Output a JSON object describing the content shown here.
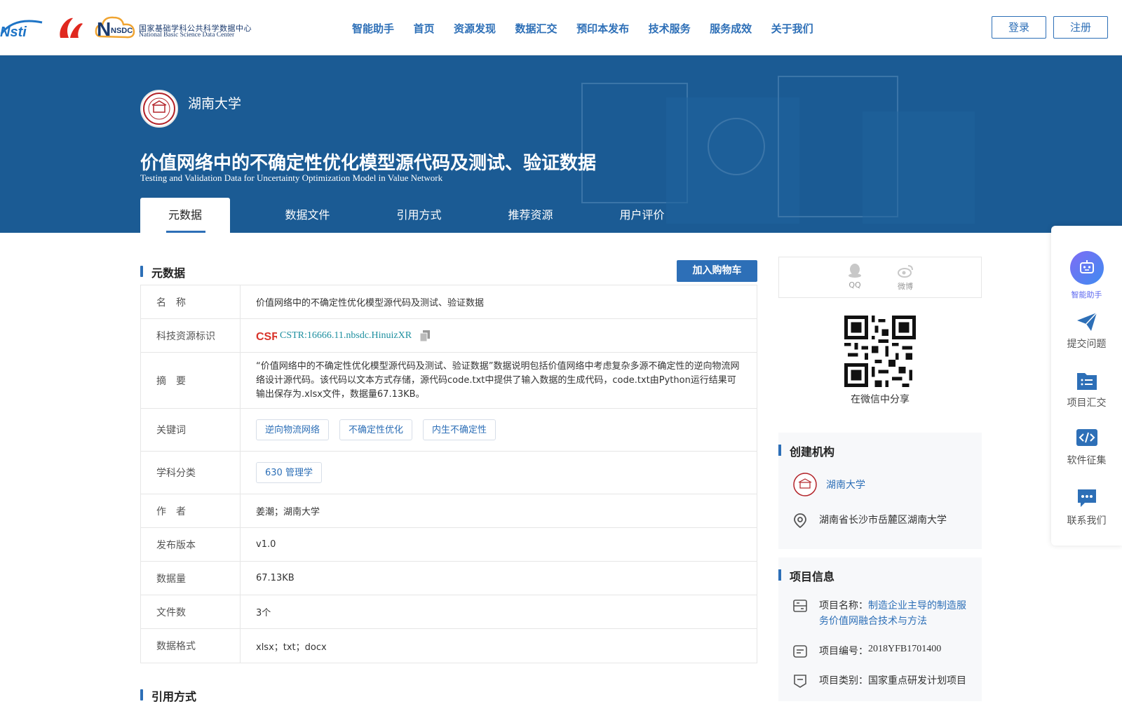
{
  "header": {
    "logo_nsdc_cn": "国家基础学科公共科学数据中心",
    "logo_nsdc_en": "National Basic Science Data Center",
    "logo_nsdc_mark": "NSDC",
    "nav": [
      "智能助手",
      "首页",
      "资源发现",
      "数据汇交",
      "预印本发布",
      "技术服务",
      "服务成效",
      "关于我们"
    ],
    "login": "登录",
    "register": "注册"
  },
  "banner": {
    "org_name": "湖南大学",
    "title_cn": "价值网络中的不确定性优化模型源代码及测试、验证数据",
    "title_en": "Testing and Validation Data for Uncertainty Optimization Model in Value Network",
    "tabs": [
      "元数据",
      "数据文件",
      "引用方式",
      "推荐资源",
      "用户评价"
    ]
  },
  "metadata": {
    "section_title": "元数据",
    "cart_button": "加入购物车",
    "rows": {
      "name_label": "名　称",
      "name_value": "价值网络中的不确定性优化模型源代码及测试、验证数据",
      "cstr_label": "科技资源标识",
      "cstr_value": "CSTR:16666.11.nbsdc.HinuizXR",
      "abstract_label": "摘　要",
      "abstract_value": "“价值网络中的不确定性优化模型源代码及测试、验证数据”数据说明包括价值网络中考虑复杂多源不确定性的逆向物流网络设计源代码。该代码以文本方式存储，源代码code.txt中提供了输入数据的生成代码，code.txt由Python运行结果可输出保存为.xlsx文件，数据量67.13KB。",
      "keywords_label": "关键词",
      "keywords": [
        "逆向物流网络",
        "不确定性优化",
        "内生不确定性"
      ],
      "subject_label": "学科分类",
      "subject": "630 管理学",
      "author_label": "作　者",
      "author_value": "姜潮；湖南大学",
      "version_label": "发布版本",
      "version_value": "v1.0",
      "size_label": "数据量",
      "size_value": "67.13KB",
      "files_label": "文件数",
      "files_value": "3个",
      "format_label": "数据格式",
      "format_value": "xlsx；txt；docx"
    }
  },
  "citation": {
    "section_title": "引用方式"
  },
  "share": {
    "qq": "QQ",
    "weibo": "微博",
    "wechat_caption": "在微信中分享"
  },
  "creator": {
    "title": "创建机构",
    "org": "湖南大学",
    "address": "湖南省长沙市岳麓区湖南大学"
  },
  "project": {
    "title": "项目信息",
    "name_label": "项目名称：",
    "name_value": "制造企业主导的制造服务价值网融合技术与方法",
    "number_label": "项目编号：",
    "number_value": "2018YFB1701400",
    "type_label": "项目类别：",
    "type_value": "国家重点研发计划项目"
  },
  "float_tools": [
    "智能助手",
    "提交问题",
    "项目汇交",
    "软件征集",
    "联系我们"
  ],
  "colors": {
    "primary": "#2d6fb7",
    "banner": "#1b5b94",
    "cstr": "#1c8f9f",
    "assistant": "#5b67f0"
  }
}
